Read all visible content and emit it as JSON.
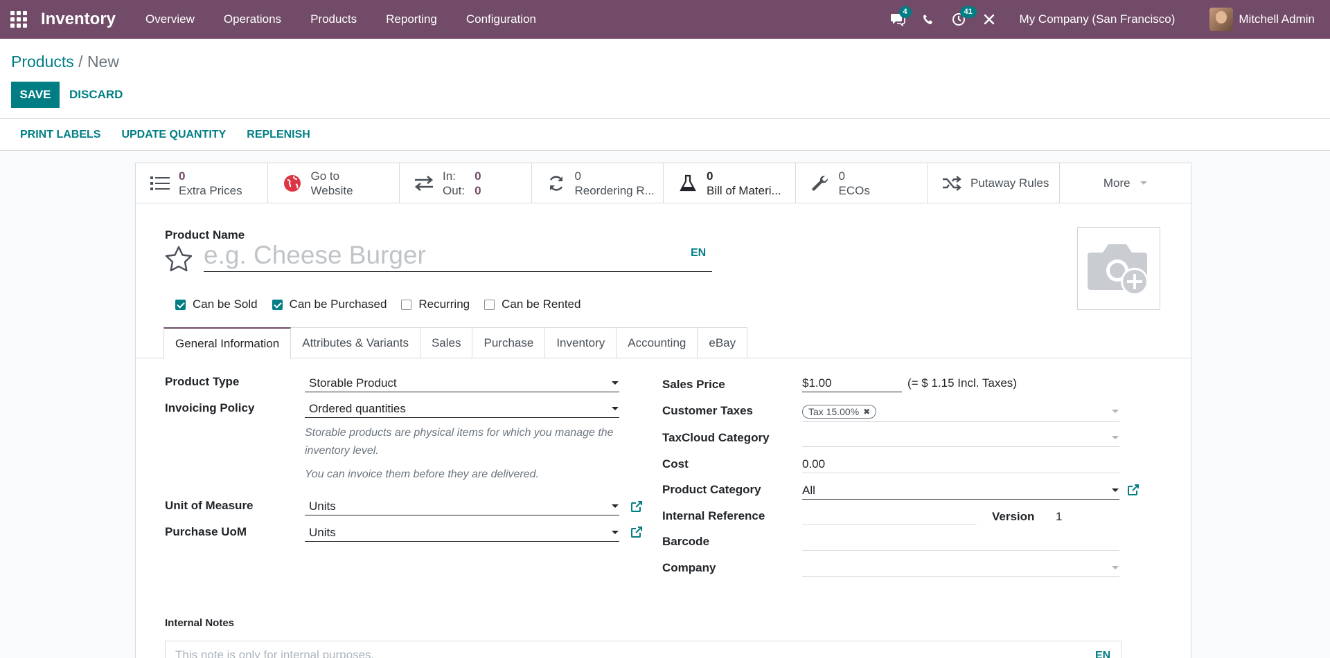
{
  "app": {
    "title": "Inventory",
    "menu": [
      "Overview",
      "Operations",
      "Products",
      "Reporting",
      "Configuration"
    ],
    "messages_badge": "4",
    "activities_badge": "41",
    "company": "My Company (San Francisco)",
    "user": "Mitchell Admin"
  },
  "breadcrumb": {
    "parent": "Products",
    "separator": "/",
    "current": "New"
  },
  "buttons": {
    "save": "SAVE",
    "discard": "DISCARD"
  },
  "actions": [
    "PRINT LABELS",
    "UPDATE QUANTITY",
    "REPLENISH"
  ],
  "smart_buttons": {
    "extra_prices": {
      "value": "0",
      "label": "Extra Prices"
    },
    "website": {
      "line1": "Go to",
      "line2": "Website"
    },
    "in_out": {
      "in_label": "In:",
      "in_value": "0",
      "out_label": "Out:",
      "out_value": "0"
    },
    "reordering": {
      "value": "0",
      "label": "Reordering R..."
    },
    "bom": {
      "value": "0",
      "label": "Bill of Materi..."
    },
    "ecos": {
      "value": "0",
      "label": "ECOs"
    },
    "putaway": {
      "label": "Putaway Rules"
    },
    "more": {
      "label": "More"
    }
  },
  "product": {
    "name_label": "Product Name",
    "name_placeholder": "e.g. Cheese Burger",
    "lang": "EN",
    "checkboxes": [
      {
        "label": "Can be Sold",
        "checked": true
      },
      {
        "label": "Can be Purchased",
        "checked": true
      },
      {
        "label": "Recurring",
        "checked": false
      },
      {
        "label": "Can be Rented",
        "checked": false
      }
    ]
  },
  "tabs": [
    "General Information",
    "Attributes & Variants",
    "Sales",
    "Purchase",
    "Inventory",
    "Accounting",
    "eBay"
  ],
  "left_fields": {
    "product_type": {
      "label": "Product Type",
      "value": "Storable Product"
    },
    "invoicing_policy": {
      "label": "Invoicing Policy",
      "value": "Ordered quantities"
    },
    "help1": "Storable products are physical items for which you manage the inventory level.",
    "help2": "You can invoice them before they are delivered.",
    "uom": {
      "label": "Unit of Measure",
      "value": "Units"
    },
    "purchase_uom": {
      "label": "Purchase UoM",
      "value": "Units"
    }
  },
  "right_fields": {
    "sales_price": {
      "label": "Sales Price",
      "value": "$1.00",
      "incl": "(= $ 1.15 Incl. Taxes)"
    },
    "customer_taxes": {
      "label": "Customer Taxes",
      "tag": "Tax 15.00%"
    },
    "taxcloud": {
      "label": "TaxCloud Category",
      "value": ""
    },
    "cost": {
      "label": "Cost",
      "value": "0.00"
    },
    "category": {
      "label": "Product Category",
      "value": "All"
    },
    "internal_ref": {
      "label": "Internal Reference",
      "value": ""
    },
    "version": {
      "label": "Version",
      "value": "1"
    },
    "barcode": {
      "label": "Barcode",
      "value": ""
    },
    "company": {
      "label": "Company",
      "value": ""
    }
  },
  "notes": {
    "label": "Internal Notes",
    "placeholder": "This note is only for internal purposes.",
    "lang": "EN"
  }
}
